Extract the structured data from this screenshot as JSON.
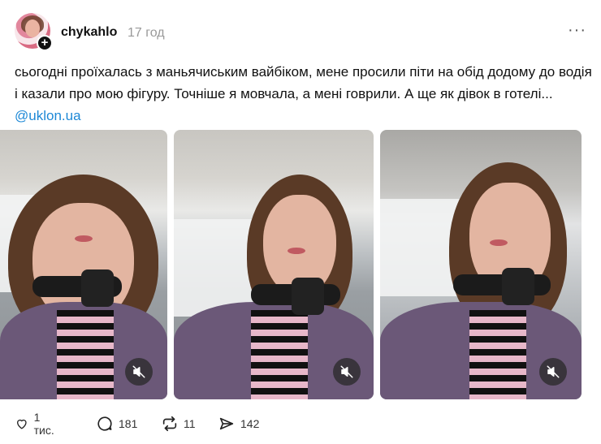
{
  "post": {
    "username": "chykahlo",
    "timestamp": "17 год",
    "more_label": "···",
    "follow_label": "+",
    "text": "сьогодні проїхалась з маньячиським вайбіком, мене просили піти на обід додому до водія і казали про мою фігуру. Точніше я мовчала, а мені говрили. А ще як дівок в готелі...",
    "mention": "@uklon.ua"
  },
  "media": [
    {
      "type": "video",
      "muted": true,
      "icon": "muted-speaker-icon"
    },
    {
      "type": "video",
      "muted": true,
      "icon": "muted-speaker-icon"
    },
    {
      "type": "video",
      "muted": true,
      "icon": "muted-speaker-icon"
    }
  ],
  "actions": {
    "likes": "1 тис.",
    "comments": "181",
    "reposts": "11",
    "shares": "142"
  },
  "icons": {
    "like": "heart-icon",
    "comment": "comment-bubble-icon",
    "repost": "repost-icon",
    "share": "send-icon"
  }
}
